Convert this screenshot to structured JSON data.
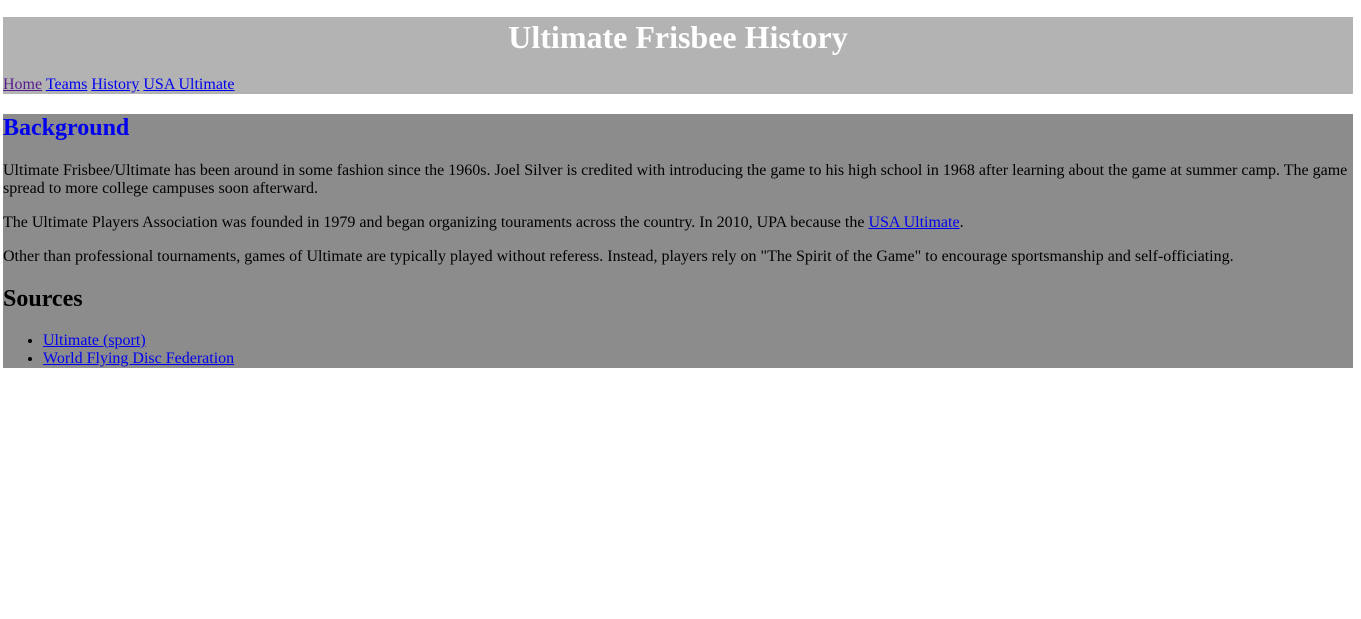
{
  "header": {
    "title": "Ultimate Frisbee History",
    "nav": [
      {
        "label": "Home",
        "visited": true
      },
      {
        "label": "Teams",
        "visited": false
      },
      {
        "label": "History",
        "visited": false
      },
      {
        "label": "USA Ultimate",
        "visited": false
      }
    ]
  },
  "main": {
    "background_heading": "Background",
    "paragraph1": "Ultimate Frisbee/Ultimate has been around in some fashion since the 1960s. Joel Silver is credited with introducing the game to his high school in 1968 after learning about the game at summer camp. The game spread to more college campuses soon afterward.",
    "paragraph2": {
      "before": "The Ultimate Players Association was founded in 1979 and began organizing touraments across the country. In 2010, UPA because the ",
      "link": "USA Ultimate",
      "after": "."
    },
    "paragraph3": "Other than professional tournaments, games of Ultimate are typically played without referess. Instead, players rely on \"The Spirit of the Game\" to encourage sportsmanship and self-officiating.",
    "sources_heading": "Sources",
    "sources": [
      "Ultimate (sport)",
      "World Flying Disc Federation"
    ]
  },
  "colors": {
    "header_bg": "#b3b3b3",
    "main_bg": "#8c8c8c",
    "link": "#0000ee",
    "visited_link": "#551a8b",
    "title_text": "#ffffff"
  }
}
